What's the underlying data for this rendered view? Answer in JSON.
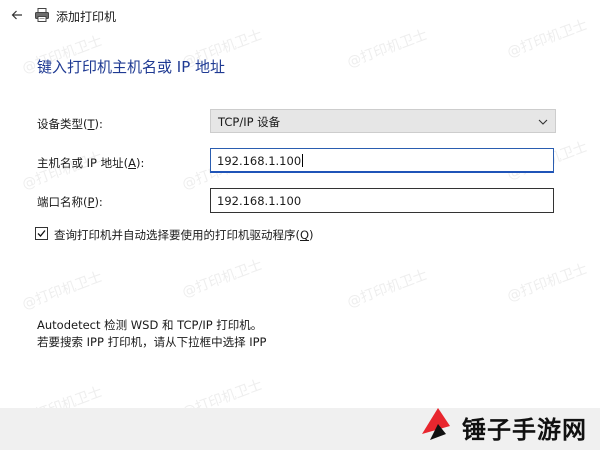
{
  "window": {
    "title": "添加打印机"
  },
  "heading": "键入打印机主机名或 IP 地址",
  "form": {
    "device_type": {
      "label_pre": "设备类型(",
      "label_key": "T",
      "label_post": "):",
      "value": "TCP/IP 设备"
    },
    "host": {
      "label_pre": "主机名或 IP 地址(",
      "label_key": "A",
      "label_post": "):",
      "value": "192.168.1.100"
    },
    "port": {
      "label_pre": "端口名称(",
      "label_key": "P",
      "label_post": "):",
      "value": "192.168.1.100"
    },
    "query_driver": {
      "label_pre": "查询打印机并自动选择要使用的打印机驱动程序(",
      "label_key": "Q",
      "label_post": ")",
      "checked": true
    }
  },
  "info": {
    "line1": "Autodetect 检测 WSD 和 TCP/IP 打印机。",
    "line2": "若要搜索 IPP 打印机，请从下拉框中选择 IPP"
  },
  "watermark_text": "@打印机卫士",
  "brand": {
    "text": "锤子手游网",
    "color": "#e8262e"
  }
}
